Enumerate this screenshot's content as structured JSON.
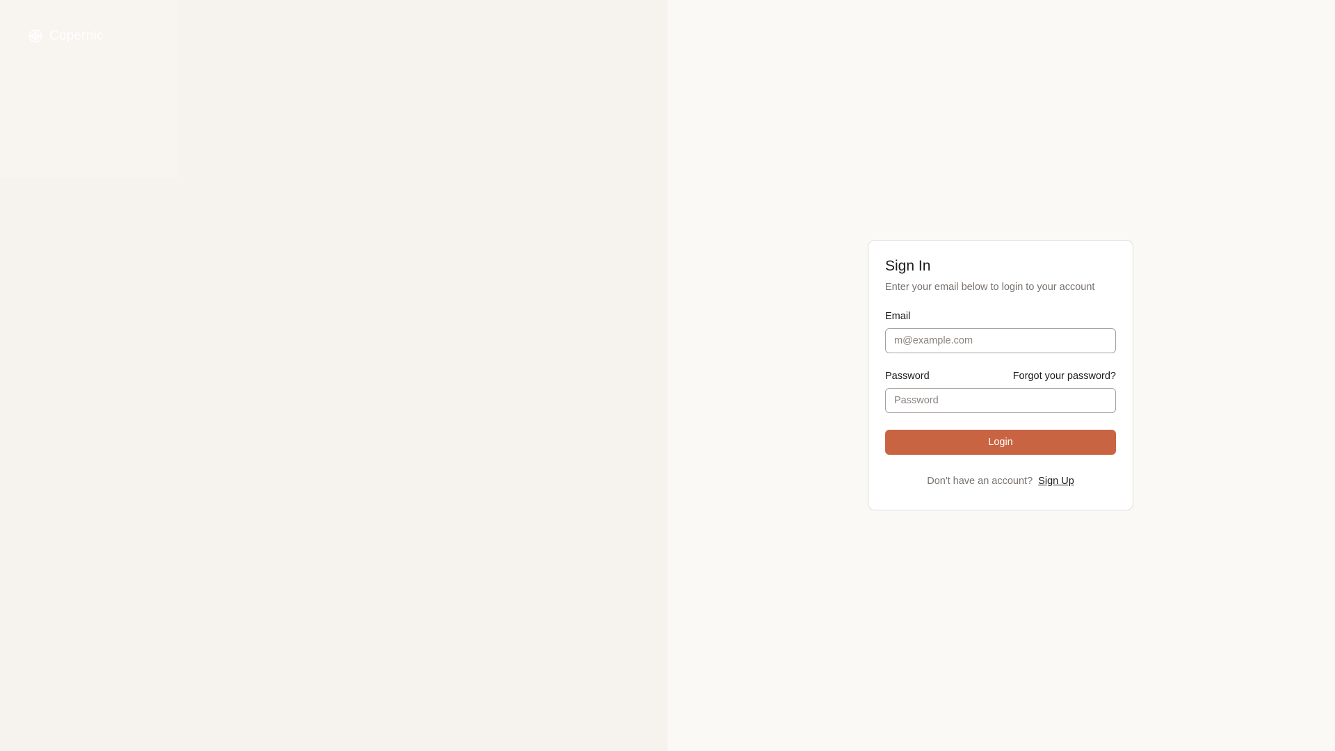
{
  "brand": {
    "name": "Copernic",
    "icon": "logo-icon"
  },
  "signin": {
    "title": "Sign In",
    "subtitle": "Enter your email below to login to your account",
    "email_label": "Email",
    "email_placeholder": "m@example.com",
    "email_value": "",
    "password_label": "Password",
    "forgot_password": "Forgot your password?",
    "password_placeholder": "Password",
    "password_value": "",
    "login_label": "Login",
    "no_account_text": "Don't have an account?",
    "signup_label": "Sign Up"
  },
  "colors": {
    "accent": "#c96442",
    "left_panel_bg": "#f6f2ed",
    "right_panel_bg": "#faf9f6"
  }
}
